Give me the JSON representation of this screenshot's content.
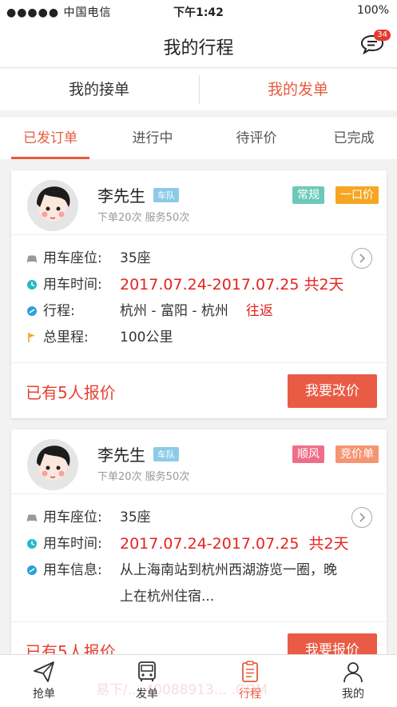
{
  "status_bar": {
    "signal": "●●●●● 中国电信",
    "time": "下午1:42",
    "battery": "100%"
  },
  "nav": {
    "title": "我的行程",
    "message_badge": "34"
  },
  "segments": {
    "left": "我的接单",
    "right": "我的发单",
    "active": "right"
  },
  "tabs": [
    {
      "label": "已发订单",
      "active": true
    },
    {
      "label": "进行中",
      "active": false
    },
    {
      "label": "待评价",
      "active": false
    },
    {
      "label": "已完成",
      "active": false
    }
  ],
  "orders": [
    {
      "name": "李先生",
      "badge": "车队",
      "stats": "下单20次 服务50次",
      "tags": [
        {
          "label": "常规",
          "color": "#6cc9b8"
        },
        {
          "label": "一口价",
          "color": "#f6a623"
        }
      ],
      "seats_label": "用车座位:",
      "seats": "35座",
      "time_label": "用车时间:",
      "time": "2017.07.24-2017.07.25 共2天",
      "route_label": "行程:",
      "route": "杭州 - 富阳 - 杭州",
      "route_type": "往返",
      "distance_label": "总里程:",
      "distance": "100公里",
      "offer": "已有5人报价",
      "button": "我要改价"
    },
    {
      "name": "李先生",
      "badge": "车队",
      "stats": "下单20次 服务50次",
      "tags": [
        {
          "label": "顺风",
          "color": "#f06d8a"
        },
        {
          "label": "竞价单",
          "color": "#f59572"
        }
      ],
      "seats_label": "用车座位:",
      "seats": "35座",
      "time_label": "用车时间:",
      "time": "2017.07.24-2017.07.25  共2天",
      "info_label": "用车信息:",
      "info_line1": "从上海南站到杭州西湖游览一圈，晚",
      "info_line2": "上在杭州住宿...",
      "offer": "已有5人报价",
      "button": "我要报价"
    }
  ],
  "bottom_nav": [
    {
      "label": "抢单",
      "icon": "paper-plane-icon",
      "active": false
    },
    {
      "label": "发单",
      "icon": "bus-icon",
      "active": false
    },
    {
      "label": "行程",
      "icon": "clipboard-icon",
      "active": true
    },
    {
      "label": "我的",
      "icon": "person-icon",
      "active": false
    }
  ],
  "watermark": "易下/... 40088913... .COM",
  "colors": {
    "accent": "#e85b3c",
    "red_text": "#e6231f",
    "button": "#ea5b45"
  }
}
